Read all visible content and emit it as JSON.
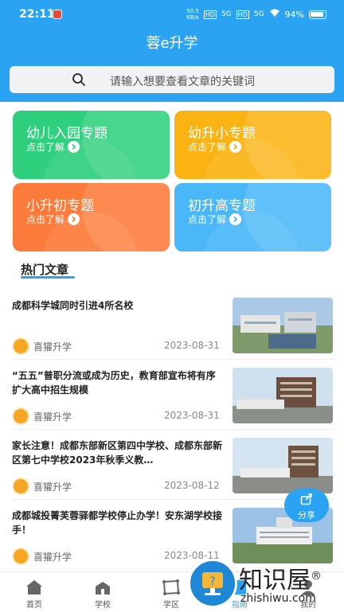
{
  "status_bar": {
    "time": "22:11",
    "network_speed": "50.5\nKB/s",
    "hd1": "HD",
    "signal1": "5G",
    "hd2": "HD",
    "signal2": "5G",
    "battery": "94%"
  },
  "header": {
    "title": "蓉e升学",
    "search_placeholder": "请输入想要查看文章的关键词"
  },
  "topics": [
    {
      "title": "幼儿入园专题",
      "subtitle": "点击了解",
      "color": "#2fd07d"
    },
    {
      "title": "幼升小专题",
      "subtitle": "点击了解",
      "color": "#fbb314"
    },
    {
      "title": "小升初专题",
      "subtitle": "点击了解",
      "color": "#fd7b3a"
    },
    {
      "title": "初升高专题",
      "subtitle": "点击了解",
      "color": "#4ab8f8"
    }
  ],
  "section": {
    "title": "热门文章"
  },
  "articles": [
    {
      "title": "成都科学城同时引进4所名校",
      "author": "喜獾升学",
      "date": "2023-08-31"
    },
    {
      "title": "“五五”普职分流或成为历史，教育部宣布将有序扩大高中招生规模",
      "author": "喜獾升学",
      "date": "2023-08-31"
    },
    {
      "title": "家长注意！成都东部新区第四中学校、成都东部新区第七中学校2023年秋季义教…",
      "author": "喜獾升学",
      "date": "2023-08-12"
    },
    {
      "title": "成都城投菁芙蓉驿都学校停止办学！安东湖学校接手！",
      "author": "喜獾升学",
      "date": "2023-08-11"
    }
  ],
  "share": {
    "label": "分享"
  },
  "tabbar": [
    {
      "label": "首页",
      "icon": "home-icon"
    },
    {
      "label": "学校",
      "icon": "school-icon"
    },
    {
      "label": "学区",
      "icon": "district-icon"
    },
    {
      "label": "指南",
      "icon": "guide-icon"
    },
    {
      "label": "我的",
      "icon": "profile-icon"
    }
  ],
  "watermark": {
    "text": "知识屋",
    "sub": "zhishiwu.com",
    "mark": "®"
  },
  "colors": {
    "primary": "#2ba3f3"
  }
}
